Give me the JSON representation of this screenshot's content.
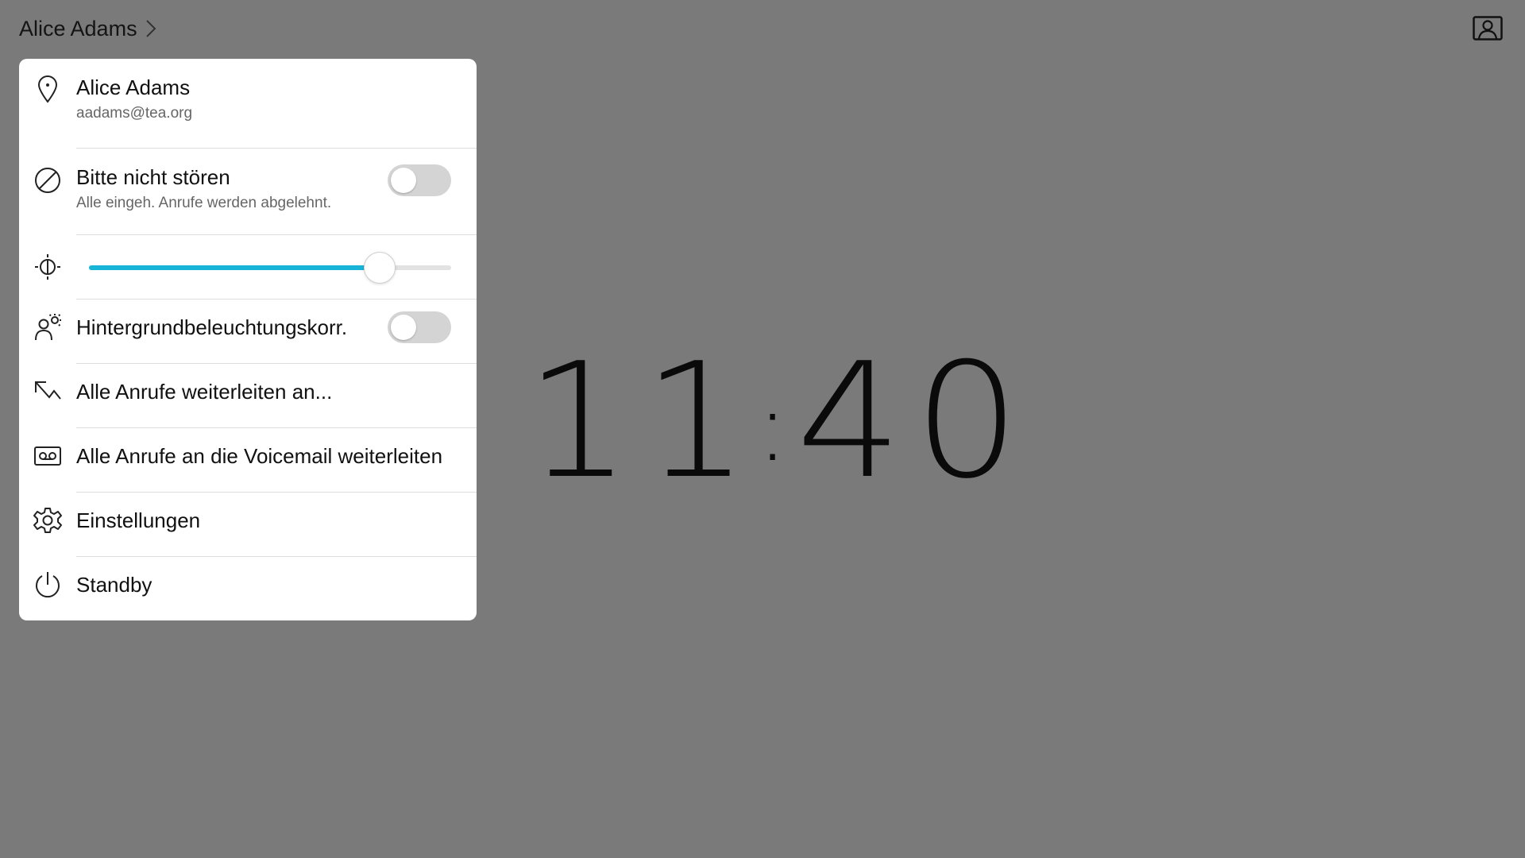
{
  "header": {
    "user_name": "Alice Adams",
    "chevron_icon": "chevron-right-icon",
    "user_icon": "user-card-icon"
  },
  "clock": {
    "hours": "11",
    "separator": ":",
    "minutes": "40"
  },
  "menu": {
    "profile": {
      "name": "Alice Adams",
      "email": "aadams@tea.org",
      "icon": "location-pin-icon"
    },
    "dnd": {
      "label": "Bitte nicht stören",
      "description": "Alle eingeh. Anrufe werden abgelehnt.",
      "icon": "do-not-disturb-icon",
      "enabled": false
    },
    "brightness": {
      "icon": "brightness-icon",
      "level_percent": 80
    },
    "backlight": {
      "label": "Hintergrundbeleuchtungskorr.",
      "icon": "backlight-icon",
      "enabled": false
    },
    "forward_all": {
      "label": "Alle Anrufe weiterleiten an...",
      "icon": "call-forward-icon"
    },
    "forward_voicemail": {
      "label": "Alle Anrufe an die Voicemail weiterleiten",
      "icon": "voicemail-icon"
    },
    "settings": {
      "label": "Einstellungen",
      "icon": "gear-icon"
    },
    "standby": {
      "label": "Standby",
      "icon": "power-icon"
    }
  },
  "colors": {
    "background": "#7a7a7a",
    "panel": "#ffffff",
    "accent": "#18b4d8",
    "toggle_off": "#d4d4d4"
  }
}
